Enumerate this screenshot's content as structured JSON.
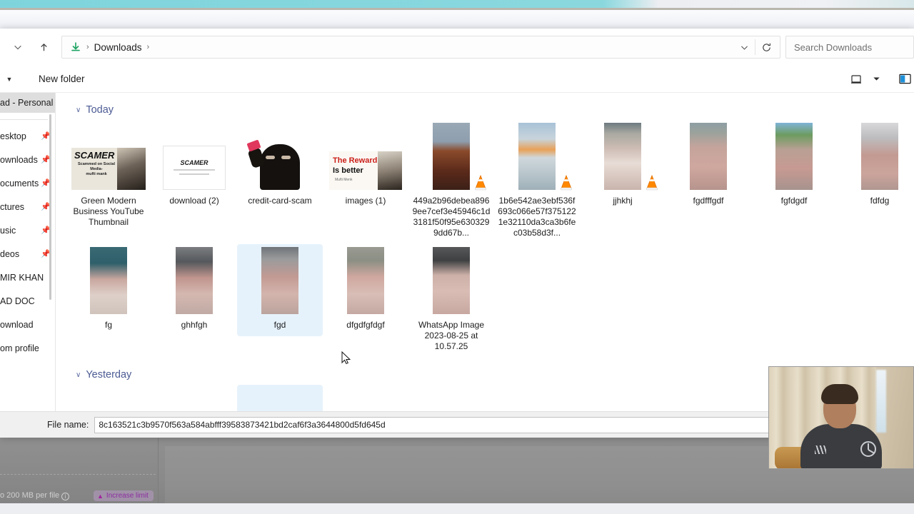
{
  "background": {
    "limit_text": "o 200 MB per file",
    "info_icon": "info-icon",
    "increase_limit_label": "Increase limit",
    "rocket_icon": "rocket-icon"
  },
  "dialog": {
    "nav": {
      "back_icon": "chevron-down-icon",
      "up_icon": "arrow-up-icon",
      "folder_icon": "downloads-folder-icon",
      "breadcrumbs": [
        "Downloads"
      ],
      "crumb_separator": "›",
      "history_chevron_icon": "chevron-down-icon",
      "refresh_icon": "refresh-icon"
    },
    "search": {
      "placeholder": "Search Downloads",
      "value": "Search Downloads"
    },
    "commandbar": {
      "overflow_chevron_icon": "chevron-down-icon",
      "new_folder_label": "New folder",
      "view_icon": "view-layout-icon",
      "view_chevron_icon": "chevron-down-icon",
      "preview_pane_icon": "preview-pane-icon"
    },
    "sidebar": {
      "header": "ad - Personal",
      "items": [
        {
          "label": "esktop",
          "pinned": true,
          "pin_icon": "pin-icon"
        },
        {
          "label": "ownloads",
          "pinned": true,
          "pin_icon": "pin-icon"
        },
        {
          "label": "ocuments",
          "pinned": true,
          "pin_icon": "pin-icon"
        },
        {
          "label": "ctures",
          "pinned": true,
          "pin_icon": "pin-icon"
        },
        {
          "label": "usic",
          "pinned": true,
          "pin_icon": "pin-icon"
        },
        {
          "label": "deos",
          "pinned": true,
          "pin_icon": "pin-icon"
        },
        {
          "label": "MIR KHAN",
          "pinned": false,
          "pin_icon": ""
        },
        {
          "label": "AD DOC",
          "pinned": false,
          "pin_icon": ""
        },
        {
          "label": "ownload",
          "pinned": false,
          "pin_icon": ""
        },
        {
          "label": "om profile",
          "pinned": false,
          "pin_icon": ""
        }
      ]
    },
    "groups": [
      {
        "name": "Today",
        "chevron_icon": "chevron-down-icon",
        "rows": [
          [
            {
              "label": "Green Modern Business YouTube Thumbnail",
              "thumb": "t-scamer",
              "selected": false,
              "video": false
            },
            {
              "label": "download (2)",
              "thumb": "t-doc",
              "selected": false,
              "video": false
            },
            {
              "label": "credit-card-scam",
              "thumb": "t-card",
              "selected": false,
              "video": false
            },
            {
              "label": "images (1)",
              "thumb": "t-reward",
              "selected": false,
              "video": false
            },
            {
              "label": "449a2b96debea8969ee7cef3e45946c1d3181f50f95e6303299dd67b...",
              "thumb": "t-mountain",
              "selected": false,
              "video": true
            },
            {
              "label": "1b6e542ae3ebf536f693c066e57f3751221e32110da3ca3b6fec03b58d3f...",
              "thumb": "t-sunset",
              "selected": false,
              "video": true
            },
            {
              "label": "jjhkhj",
              "thumb": "t-street1",
              "selected": false,
              "video": true
            },
            {
              "label": "fgdfffgdf",
              "thumb": "t-road",
              "selected": false,
              "video": false
            },
            {
              "label": "fgfdgdf",
              "thumb": "t-palm",
              "selected": false,
              "video": false
            },
            {
              "label": "fdfdg",
              "thumb": "t-car",
              "selected": false,
              "video": false
            }
          ],
          [
            {
              "label": "fg",
              "thumb": "t-bin",
              "selected": false,
              "video": false
            },
            {
              "label": "ghhfgh",
              "thumb": "t-carpark",
              "selected": false,
              "video": false
            },
            {
              "label": "fgd",
              "thumb": "t-fgd",
              "selected": true,
              "video": false
            },
            {
              "label": "dfgdfgfdgf",
              "thumb": "t-pole",
              "selected": false,
              "video": false
            },
            {
              "label": "WhatsApp Image 2023-08-25 at 10.57.25",
              "thumb": "t-manhole",
              "selected": false,
              "video": false
            }
          ]
        ]
      },
      {
        "name": "Yesterday",
        "chevron_icon": "chevron-down-icon",
        "rows": [
          [
            {
              "label": "",
              "thumb": "t-dark",
              "selected": false,
              "video": false
            },
            {
              "label": "",
              "thumb": "t-pale",
              "selected": false,
              "video": false
            },
            {
              "label": "",
              "thumb": "t-pale",
              "selected": true,
              "video": false
            }
          ]
        ]
      }
    ],
    "filename": {
      "label": "File name:",
      "value": "8c163521c3b9570f563a584abfff39583873421bd2caf6f3a3644800d5fd645d"
    }
  },
  "webcam": {
    "name": "webcam-overlay"
  },
  "colors": {
    "group_header": "#4c5b94",
    "selection": "#e6f2fb",
    "accent_top": "#7fd4dc",
    "increase_limit": "#8b2f9e"
  }
}
